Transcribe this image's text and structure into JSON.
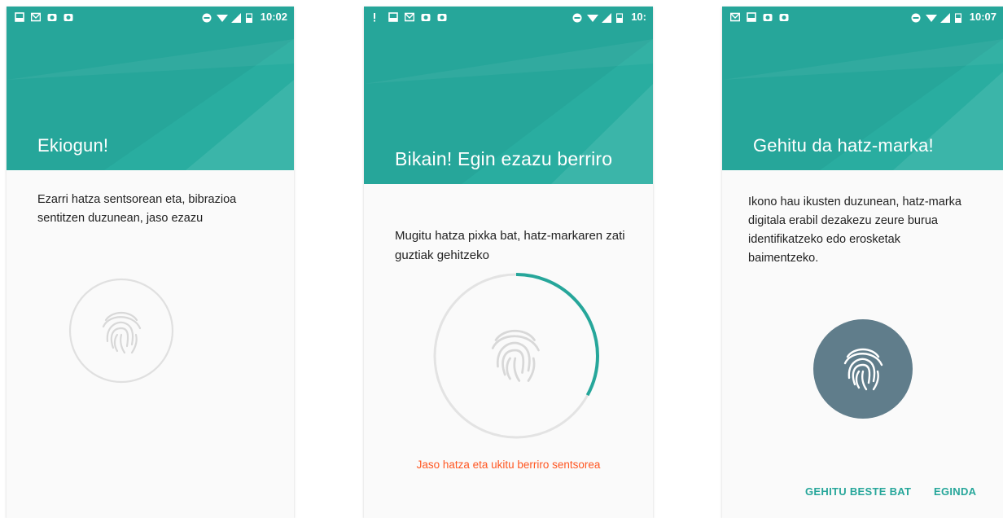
{
  "colors": {
    "accent": "#26a69a",
    "error": "#ff5722",
    "ring_track": "#e0e0e0",
    "badge": "#607d8b"
  },
  "screens": [
    {
      "status_time": "10:02",
      "title": "Ekiogun!",
      "description": "Ezarri hatza sentsorean eta, bibrazioa sentitzen duzunean, jaso ezazu"
    },
    {
      "status_time": "10:",
      "title": "Bikain! Egin ezazu berriro",
      "description": "Mugitu hatza pixka bat, hatz-markaren zati guztiak gehitzeko",
      "error": "Jaso hatza eta ukitu berriro sentsorea"
    },
    {
      "status_time": "10:07",
      "title": "Gehitu da hatz-marka!",
      "description": "Ikono hau ikusten duzunean, hatz-marka digitala erabil dezakezu zeure burua identifikatzeko edo erosketak baimentzeko.",
      "buttons": {
        "add_another": "GEHITU BESTE BAT",
        "done": "EGINDA"
      }
    }
  ],
  "enroll_progress": 0.33
}
